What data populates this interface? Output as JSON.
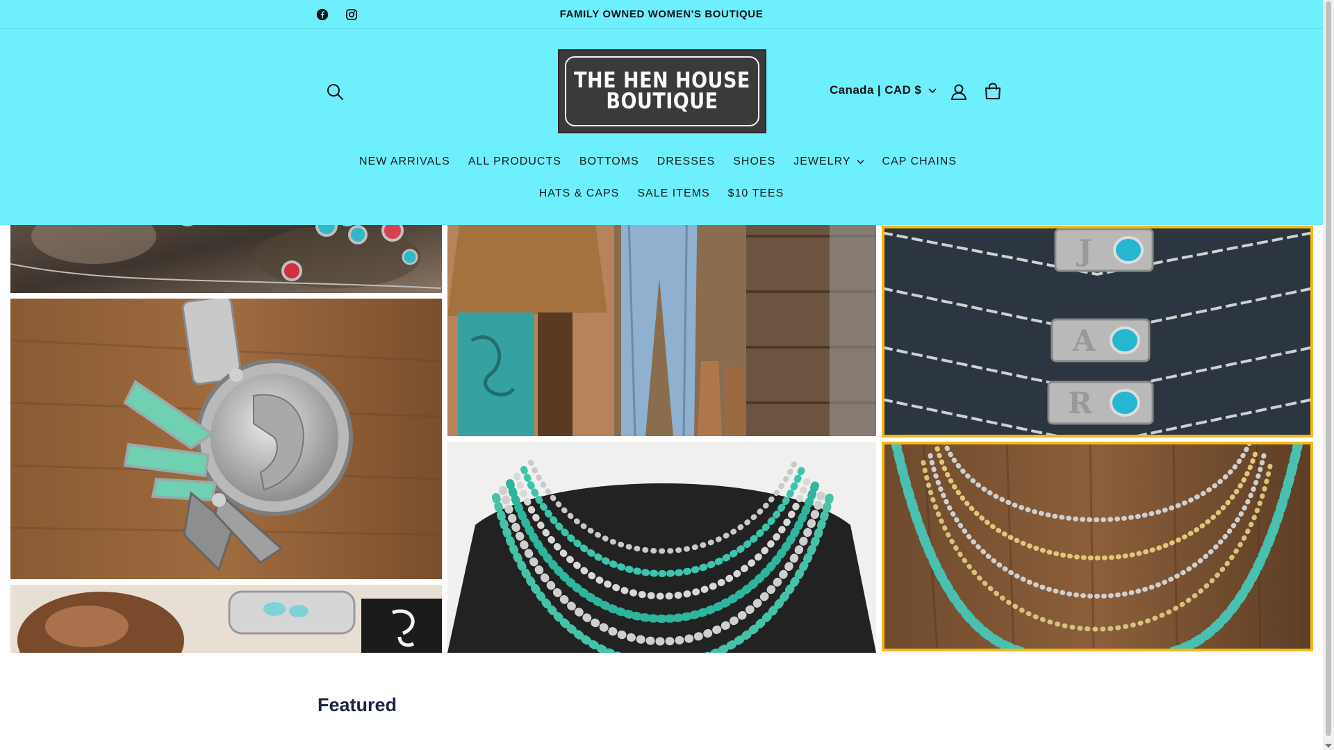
{
  "announcement": {
    "text": "FAMILY OWNED WOMEN'S BOUTIQUE",
    "social": [
      "facebook-icon",
      "instagram-icon"
    ]
  },
  "header": {
    "logo_line1": "THE HEN HOUSE",
    "logo_line2": "BOUTIQUE",
    "currency": "Canada | CAD $",
    "icons": [
      "search-icon",
      "account-icon",
      "cart-icon"
    ],
    "bg_color": "#6eeffd"
  },
  "nav": {
    "row1": [
      "NEW ARRIVALS",
      "ALL PRODUCTS",
      "BOTTOMS",
      "DRESSES",
      "SHOES",
      "JEWELRY",
      "CAP CHAINS"
    ],
    "row2": [
      "HATS & CAPS",
      "SALE ITEMS",
      "$10 TEES"
    ]
  },
  "collage": {
    "tiles": [
      {
        "subject": "turquoise jewelry on rock"
      },
      {
        "subject": "buffalo nickel pendant"
      },
      {
        "subject": "rings and cuff bracelet"
      },
      {
        "subject": "jeans and handbag display"
      },
      {
        "subject": "turquoise and pearl necklaces on bust"
      },
      {
        "subject": "initial nameplate necklaces"
      },
      {
        "subject": "beaded turquoise necklaces"
      }
    ],
    "highlight_color": "#f4b81c"
  },
  "featured": {
    "heading": "Featured"
  }
}
